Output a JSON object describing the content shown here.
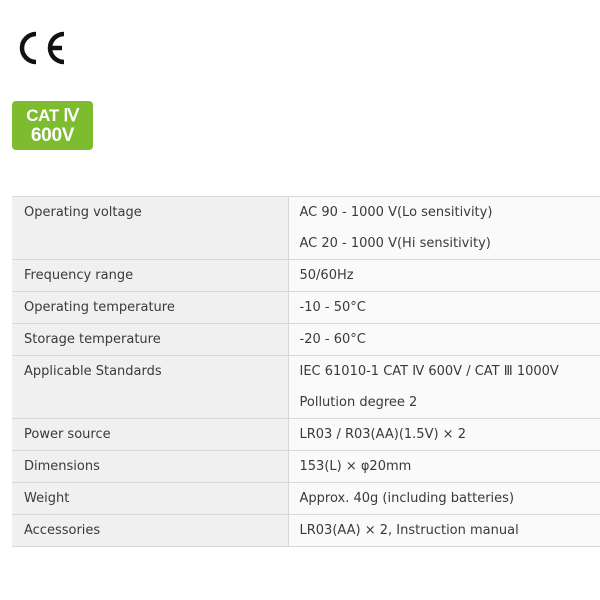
{
  "ce_mark": {
    "text": "CE"
  },
  "cat_badge": {
    "line1": "CAT Ⅳ",
    "line2": "600V",
    "color": "#7dbb2f"
  },
  "specs": [
    {
      "label": "Operating voltage",
      "values": [
        "AC 90 - 1000 V(Lo sensitivity)",
        "AC 20 - 1000 V(Hi sensitivity)"
      ]
    },
    {
      "label": "Frequency range",
      "values": [
        "50/60Hz"
      ]
    },
    {
      "label": "Operating temperature",
      "values": [
        "-10 - 50°C"
      ]
    },
    {
      "label": "Storage temperature",
      "values": [
        "-20 - 60°C"
      ]
    },
    {
      "label": "Applicable Standards",
      "values": [
        "IEC 61010-1 CAT Ⅳ 600V / CAT Ⅲ 1000V",
        "Pollution degree 2"
      ]
    },
    {
      "label": "Power source",
      "values": [
        "LR03 / R03(AA)(1.5V) × 2"
      ]
    },
    {
      "label": "Dimensions",
      "values": [
        "153(L) × φ20mm"
      ]
    },
    {
      "label": "Weight",
      "values": [
        "Approx. 40g (including batteries)"
      ]
    },
    {
      "label": "Accessories",
      "values": [
        "LR03(AA) × 2, Instruction manual"
      ]
    }
  ]
}
